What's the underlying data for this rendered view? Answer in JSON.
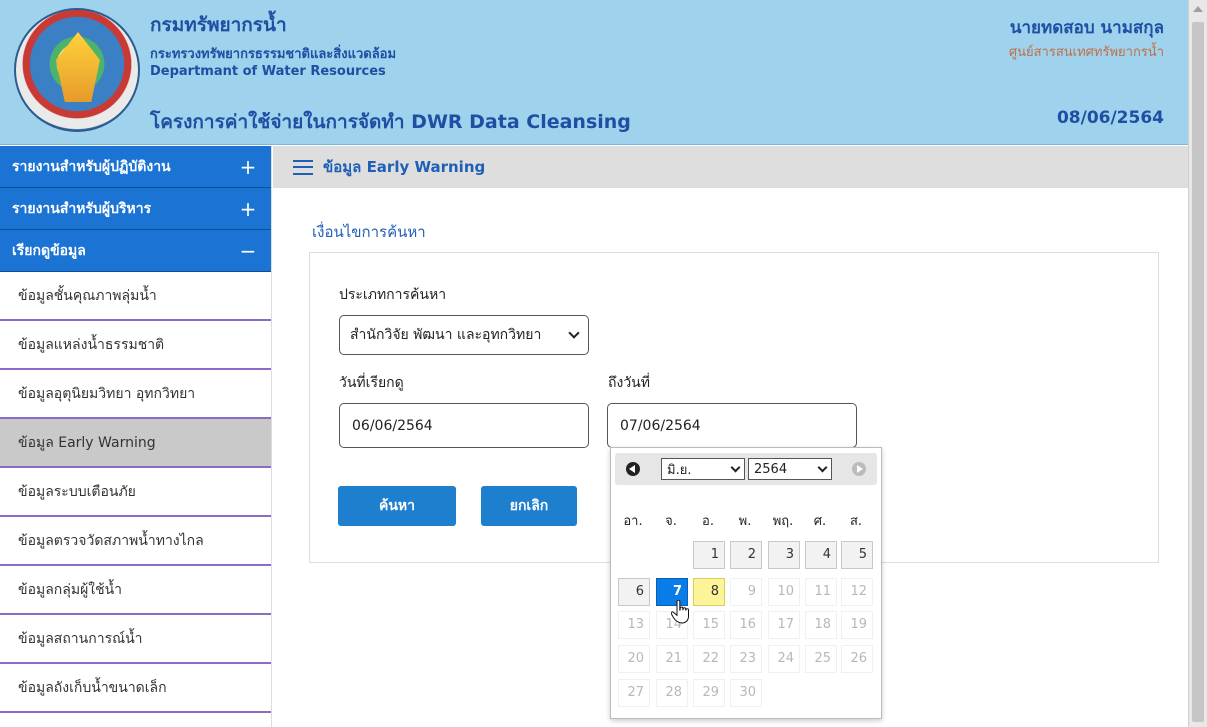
{
  "header": {
    "dept_th": "กรมทรัพยากรน้ำ",
    "ministry": "กระทรวงทรัพยากรธรรมชาติและสิ่งแวดล้อม",
    "dept_en": "Departmant of Water Resources",
    "project": "โครงการค่าใช้จ่ายในการจัดทำ DWR Data Cleansing",
    "user_name": "นายทดสอบ นามสกุล",
    "user_unit": "ศูนย์สารสนเทศทรัพยากรน้ำ",
    "current_date": "08/06/2564"
  },
  "sidebar": {
    "groups": [
      {
        "label": "รายงานสำหรับผู้ปฏิบัติงาน",
        "toggle": "+"
      },
      {
        "label": "รายงานสำหรับผู้บริหาร",
        "toggle": "+"
      },
      {
        "label": "เรียกดูข้อมูล",
        "toggle": "−"
      }
    ],
    "items": [
      {
        "label": "ข้อมูลชั้นคุณภาพลุ่มน้ำ"
      },
      {
        "label": "ข้อมูลแหล่งน้ำธรรมชาติ"
      },
      {
        "label": "ข้อมูลอุตุนิยมวิทยา อุทกวิทยา"
      },
      {
        "label": "ข้อมูล Early Warning"
      },
      {
        "label": "ข้อมูลระบบเตือนภัย"
      },
      {
        "label": "ข้อมูลตรวจวัดสภาพน้ำทางไกล"
      },
      {
        "label": "ข้อมูลกลุ่มผู้ใช้น้ำ"
      },
      {
        "label": "ข้อมูลสถานการณ์น้ำ"
      },
      {
        "label": "ข้อมูลถังเก็บน้ำขนาดเล็ก"
      }
    ],
    "active_index": 3
  },
  "main": {
    "page_title": "ข้อมูล Early Warning",
    "section_title": "เงื่อนไขการค้นหา",
    "search_type_label": "ประเภทการค้นหา",
    "search_type_value": "สำนักวิจัย พัฒนา และอุทกวิทยา",
    "date_from_label": "วันที่เรียกดู",
    "date_from_value": "06/06/2564",
    "date_to_label": "ถึงวันที่",
    "date_to_value": "07/06/2564",
    "search_button": "ค้นหา",
    "cancel_button": "ยกเลิก"
  },
  "datepicker": {
    "month": "มิ.ย.",
    "year": "2564",
    "weekdays": [
      "อา.",
      "จ.",
      "อ.",
      "พ.",
      "พฤ.",
      "ศ.",
      "ส."
    ],
    "weeks": [
      [
        null,
        null,
        1,
        2,
        3,
        4,
        5
      ],
      [
        6,
        7,
        8,
        9,
        10,
        11,
        12
      ],
      [
        13,
        14,
        15,
        16,
        17,
        18,
        19
      ],
      [
        20,
        21,
        22,
        23,
        24,
        25,
        26
      ],
      [
        27,
        28,
        29,
        30,
        null,
        null,
        null
      ]
    ],
    "selected_day": 7,
    "today_day": 8,
    "max_enabled_day": 8
  },
  "colors": {
    "header_bg": "#9fd2ec",
    "sidebar_head_bg": "#1b73d3",
    "accent": "#1f5fb8",
    "button_bg": "#1e7fcf",
    "selected_day": "#0a7ce8",
    "today_day": "#fdf49a"
  },
  "icons": {
    "menu": "hamburger-icon",
    "prev_month": "circle-arrow-left-icon",
    "next_month": "circle-arrow-right-icon",
    "cursor": "hand-pointer-icon"
  }
}
